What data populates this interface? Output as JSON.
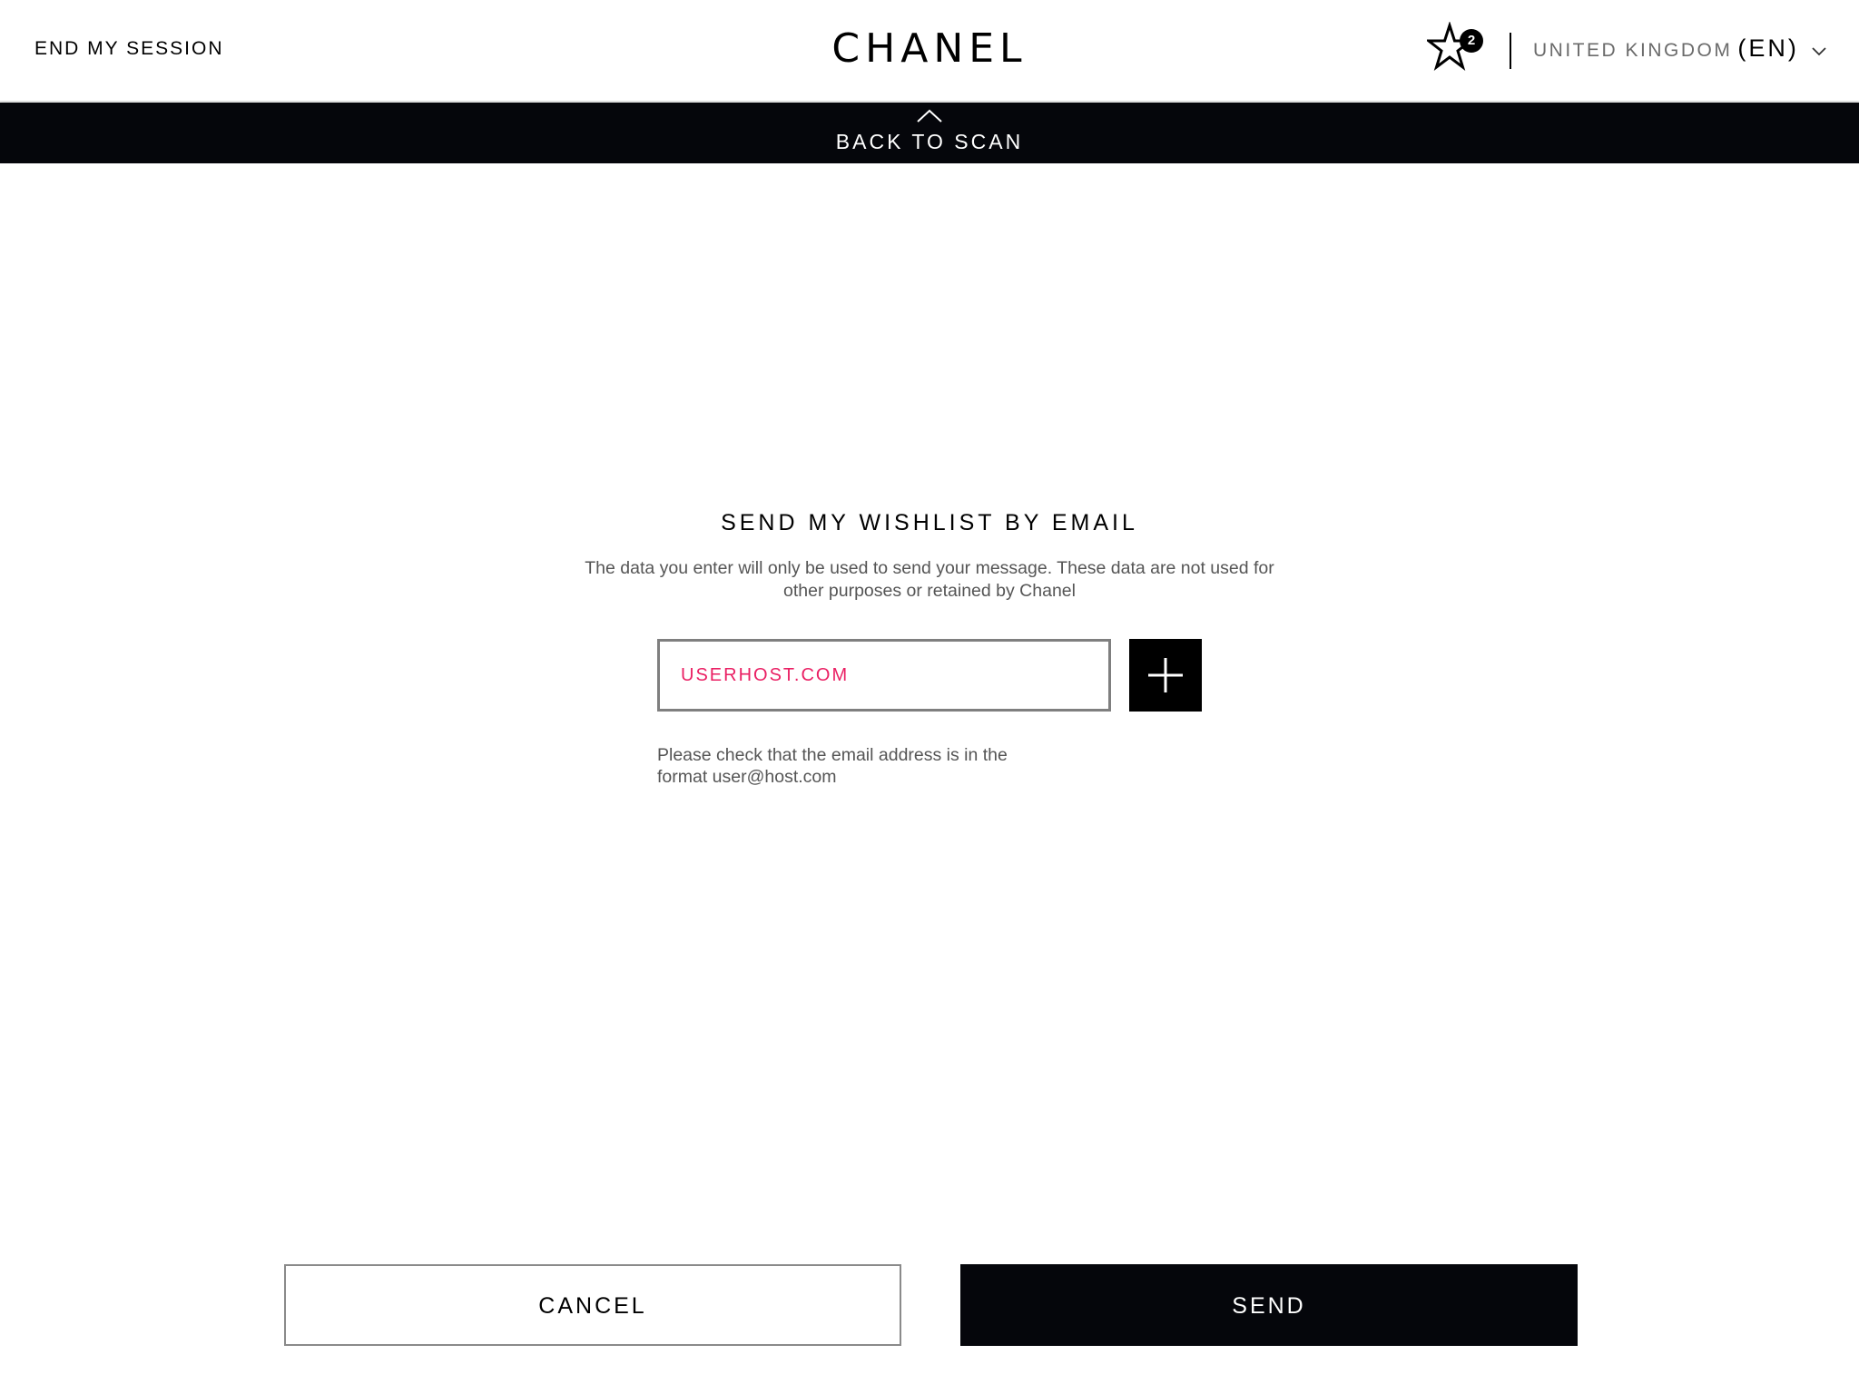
{
  "header": {
    "end_session": "END MY SESSION",
    "logo": "CHANEL",
    "wishlist_count": "2",
    "country": "UNITED KINGDOM",
    "language": "(EN)"
  },
  "back_bar": {
    "label": "BACK TO SCAN"
  },
  "form": {
    "title": "SEND MY WISHLIST BY EMAIL",
    "description": "The data you enter will only be used to send your message. These data are not used for other purposes or retained by Chanel",
    "email_value": "USERHOST.COM",
    "error_message": "Please check that the email address is in the format user@host.com"
  },
  "actions": {
    "cancel": "CANCEL",
    "send": "SEND"
  },
  "icons": {
    "wishlist": "star-icon",
    "dropdown": "chevron-down-icon",
    "back": "chevron-up-icon",
    "add": "plus-icon"
  },
  "colors": {
    "error_text": "#ea1f63",
    "dark_bar": "#05060b"
  }
}
